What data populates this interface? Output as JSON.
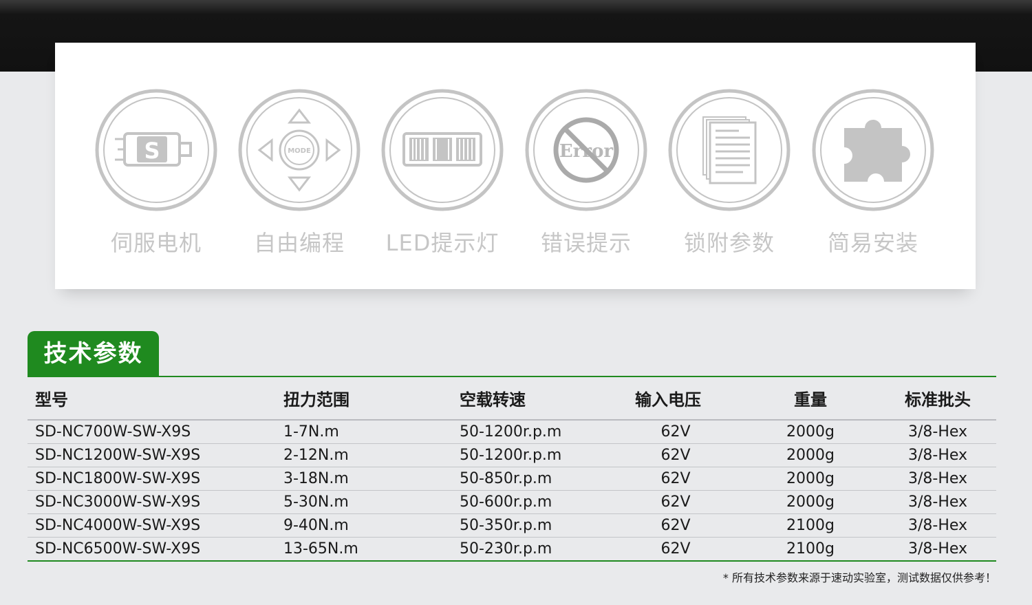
{
  "features": [
    {
      "label": "伺服电机",
      "icon": "servo-motor-icon"
    },
    {
      "label": "自由编程",
      "icon": "mode-dpad-icon"
    },
    {
      "label": "LED提示灯",
      "icon": "led-indicator-icon"
    },
    {
      "label": "错误提示",
      "icon": "error-prohibited-icon"
    },
    {
      "label": "锁附参数",
      "icon": "document-stack-icon"
    },
    {
      "label": "简易安装",
      "icon": "puzzle-piece-icon"
    }
  ],
  "icon_text": {
    "servo_letter": "S",
    "mode_text": "MODE",
    "error_text": "Error"
  },
  "section": {
    "title": "技术参数"
  },
  "table": {
    "headers": [
      "型号",
      "扭力范围",
      "空载转速",
      "输入电压",
      "重量",
      "标准批头"
    ],
    "rows": [
      [
        "SD-NC700W-SW-X9S",
        "1-7N.m",
        "50-1200r.p.m",
        "62V",
        "2000g",
        "3/8-Hex"
      ],
      [
        "SD-NC1200W-SW-X9S",
        "2-12N.m",
        "50-1200r.p.m",
        "62V",
        "2000g",
        "3/8-Hex"
      ],
      [
        "SD-NC1800W-SW-X9S",
        "3-18N.m",
        "50-850r.p.m",
        "62V",
        "2000g",
        "3/8-Hex"
      ],
      [
        "SD-NC3000W-SW-X9S",
        "5-30N.m",
        "50-600r.p.m",
        "62V",
        "2000g",
        "3/8-Hex"
      ],
      [
        "SD-NC4000W-SW-X9S",
        "9-40N.m",
        "50-350r.p.m",
        "62V",
        "2100g",
        "3/8-Hex"
      ],
      [
        "SD-NC6500W-SW-X9S",
        "13-65N.m",
        "50-230r.p.m",
        "62V",
        "2100g",
        "3/8-Hex"
      ]
    ]
  },
  "footnote": "* 所有技术参数来源于速动实验室，测试数据仅供参考！",
  "colors": {
    "accent": "#1f8a1f",
    "icon_gray": "#c4c4c4",
    "band": "#151515"
  }
}
